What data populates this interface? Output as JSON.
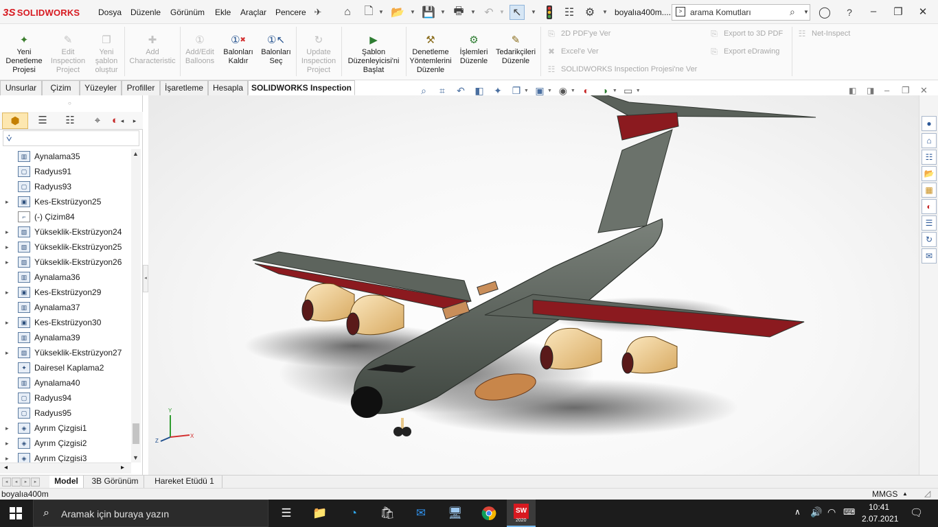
{
  "app": {
    "brand": "SOLIDWORKS",
    "brand_prefix": "3S",
    "document_title": "boyalıa400m...."
  },
  "menu": [
    "Dosya",
    "Düzenle",
    "Görünüm",
    "Ekle",
    "Araçlar",
    "Pencere"
  ],
  "search": {
    "placeholder": "arama Komutları"
  },
  "command_manager": {
    "buttons": [
      {
        "label": "Yeni Denetleme Projesi",
        "lines": [
          "Yeni",
          "Denetleme",
          "Projesi"
        ],
        "enabled": true
      },
      {
        "label": "Edit Inspection Project",
        "lines": [
          "Edit",
          "Inspection",
          "Project"
        ],
        "enabled": false
      },
      {
        "label": "Yeni şablon oluştur",
        "lines": [
          "Yeni",
          "şablon",
          "oluştur"
        ],
        "enabled": false
      },
      {
        "label": "Add Characteristic",
        "lines": [
          "Add",
          "Characteristic"
        ],
        "enabled": false
      },
      {
        "label": "Add/Edit Balloons",
        "lines": [
          "Add/Edit",
          "Balloons"
        ],
        "enabled": false
      },
      {
        "label": "Balonları Kaldır",
        "lines": [
          "Balonları",
          "Kaldır"
        ],
        "enabled": true
      },
      {
        "label": "Balonları Seç",
        "lines": [
          "Balonları",
          "Seç"
        ],
        "enabled": true
      },
      {
        "label": "Update Inspection Project",
        "lines": [
          "Update",
          "Inspection",
          "Project"
        ],
        "enabled": false
      },
      {
        "label": "Şablon Düzenleyicisi'ni Başlat",
        "lines": [
          "Şablon",
          "Düzenleyicisi'ni",
          "Başlat"
        ],
        "enabled": true
      },
      {
        "label": "Denetleme Yöntemlerini Düzenle",
        "lines": [
          "Denetleme",
          "Yöntemlerini",
          "Düzenle"
        ],
        "enabled": true
      },
      {
        "label": "İşlemleri Düzenle",
        "lines": [
          "İşlemleri",
          "Düzenle"
        ],
        "enabled": true
      },
      {
        "label": "Tedarikçileri Düzenle",
        "lines": [
          "Tedarikçileri",
          "Düzenle"
        ],
        "enabled": true
      }
    ],
    "export_items": [
      "2D PDF'ye Ver",
      "Excel'e Ver",
      "SOLIDWORKS Inspection Projesi'ne Ver",
      "Export to 3D PDF",
      "Export eDrawing",
      "Net-Inspect"
    ]
  },
  "tabs": [
    "Unsurlar",
    "Çizim",
    "Yüzeyler",
    "Profiller",
    "İşaretleme",
    "Hesapla",
    "SOLIDWORKS Inspection"
  ],
  "active_tab": "SOLIDWORKS Inspection",
  "feature_tree": [
    {
      "label": "Aynalama35",
      "expandable": false,
      "icon": "mirror-icon"
    },
    {
      "label": "Radyus91",
      "expandable": false,
      "icon": "fillet-icon"
    },
    {
      "label": "Radyus93",
      "expandable": false,
      "icon": "fillet-icon"
    },
    {
      "label": "Kes-Ekstrüzyon25",
      "expandable": true,
      "icon": "cut-extrude-icon"
    },
    {
      "label": "(-) Çizim84",
      "expandable": false,
      "icon": "sketch-icon"
    },
    {
      "label": "Yükseklik-Ekstrüzyon24",
      "expandable": true,
      "icon": "boss-extrude-icon"
    },
    {
      "label": "Yükseklik-Ekstrüzyon25",
      "expandable": true,
      "icon": "boss-extrude-icon"
    },
    {
      "label": "Yükseklik-Ekstrüzyon26",
      "expandable": true,
      "icon": "boss-extrude-icon"
    },
    {
      "label": "Aynalama36",
      "expandable": false,
      "icon": "mirror-icon"
    },
    {
      "label": "Kes-Ekstrüzyon29",
      "expandable": true,
      "icon": "cut-extrude-icon"
    },
    {
      "label": "Aynalama37",
      "expandable": false,
      "icon": "mirror-icon"
    },
    {
      "label": "Kes-Ekstrüzyon30",
      "expandable": true,
      "icon": "cut-extrude-icon"
    },
    {
      "label": "Aynalama39",
      "expandable": false,
      "icon": "mirror-icon"
    },
    {
      "label": "Yükseklik-Ekstrüzyon27",
      "expandable": true,
      "icon": "boss-extrude-icon"
    },
    {
      "label": "Dairesel Kaplama2",
      "expandable": false,
      "icon": "circular-pattern-icon"
    },
    {
      "label": "Aynalama40",
      "expandable": false,
      "icon": "mirror-icon"
    },
    {
      "label": "Radyus94",
      "expandable": false,
      "icon": "fillet-icon"
    },
    {
      "label": "Radyus95",
      "expandable": false,
      "icon": "fillet-icon"
    },
    {
      "label": "Ayrım Çizgisi1",
      "expandable": true,
      "icon": "split-line-icon"
    },
    {
      "label": "Ayrım Çizgisi2",
      "expandable": true,
      "icon": "split-line-icon"
    },
    {
      "label": "Ayrım Çizgisi3",
      "expandable": true,
      "icon": "split-line-icon"
    }
  ],
  "bottom_tabs": [
    "Model",
    "3B Görünüm",
    "Hareket Etüdü 1"
  ],
  "active_bottom_tab": "Model",
  "status": {
    "left": "boyalıa400m",
    "units": "MMGS"
  },
  "triad": {
    "x": "X",
    "y": "Y",
    "z": "Z"
  },
  "taskbar": {
    "search_placeholder": "Aramak için buraya yazın",
    "apps": [
      "task-view",
      "file-explorer",
      "edge",
      "store",
      "mail",
      "network-computer",
      "chrome",
      "solidworks"
    ],
    "sw_badge": "2020",
    "time": "10:41",
    "date": "2.07.2021"
  },
  "colors": {
    "brand_red": "#d71920",
    "aircraft_body": "#5f6660",
    "aircraft_trim": "#8b1a1f",
    "engine_nacelle": "#f0d29a"
  }
}
